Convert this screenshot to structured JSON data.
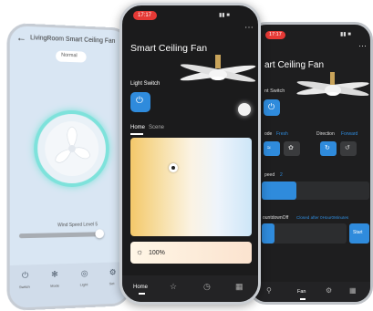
{
  "left": {
    "title": "LivingRoom Smart Ceiling Fan",
    "mode_badge": "Normal",
    "wind_speed_label": "Wind Speed Level 5",
    "nav": [
      "Switch",
      "Mode",
      "Light",
      "Set"
    ]
  },
  "center": {
    "time": "17:17",
    "title": "Smart Ceiling Fan",
    "light_switch_label": "Light Switch",
    "tabs": [
      "Home",
      "Scene"
    ],
    "brightness": "100%",
    "nav_home": "Home"
  },
  "right": {
    "time": "17:17",
    "title": "art Ceiling Fan",
    "switch_label": "nt Switch",
    "mode_label": "ode",
    "mode_value": "Fresh",
    "direction_label": "Direction",
    "direction_value": "Forward",
    "speed_label": "peed",
    "speed_value": "2",
    "countdown_label": "ountdownOff",
    "countdown_value": "Closed after 0Hour0Minutes",
    "start_button": "Start",
    "nav_fan": "Fan"
  },
  "colors": {
    "accent_blue": "#2f8bdc",
    "dark_bg": "#1b1b1c",
    "left_bg": "#d9e6f3",
    "status_red": "#e53935",
    "fan_ring": "#7ee2db"
  }
}
